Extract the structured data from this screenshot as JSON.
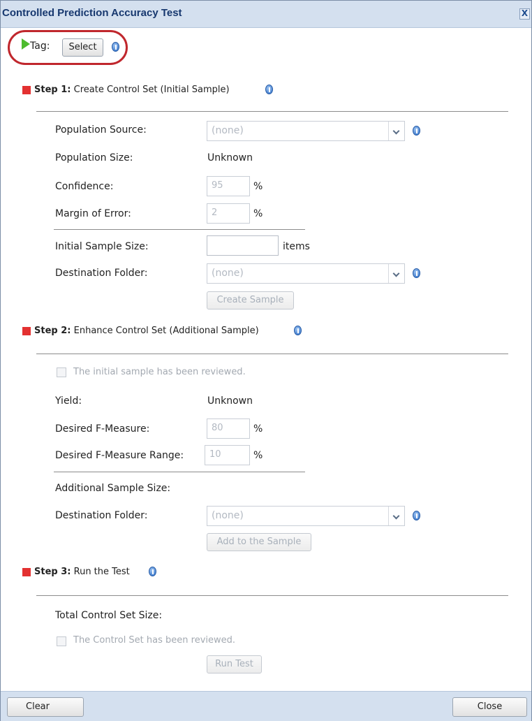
{
  "dialog": {
    "title": "Controlled Prediction Accuracy Test",
    "close_glyph": "X"
  },
  "tag": {
    "label": "Tag:",
    "select_label": "Select"
  },
  "step1": {
    "prefix": "Step 1:",
    "title": "Create Control Set (Initial Sample)",
    "population_source_label": "Population Source:",
    "population_source_value": "(none)",
    "population_size_label": "Population Size:",
    "population_size_value": "Unknown",
    "confidence_label": "Confidence:",
    "confidence_value": "95",
    "confidence_unit": "%",
    "margin_label": "Margin of Error:",
    "margin_value": "2",
    "margin_unit": "%",
    "initial_sample_label": "Initial Sample Size:",
    "initial_sample_value": "",
    "initial_sample_unit": "items",
    "destination_label": "Destination Folder:",
    "destination_value": "(none)",
    "create_sample_label": "Create Sample"
  },
  "step2": {
    "prefix": "Step 2:",
    "title": "Enhance Control Set (Additional Sample)",
    "reviewed_label": "The initial sample has been reviewed.",
    "yield_label": "Yield:",
    "yield_value": "Unknown",
    "fmeasure_label": "Desired F-Measure:",
    "fmeasure_value": "80",
    "fmeasure_unit": "%",
    "fmeasure_range_label": "Desired F-Measure Range:",
    "fmeasure_range_value": "10",
    "fmeasure_range_unit": "%",
    "additional_sample_label": "Additional Sample Size:",
    "destination_label": "Destination Folder:",
    "destination_value": "(none)",
    "add_sample_label": "Add to the Sample"
  },
  "step3": {
    "prefix": "Step 3:",
    "title": "Run the Test",
    "total_label": "Total Control Set Size:",
    "reviewed_label": "The Control Set has been reviewed.",
    "run_label": "Run Test"
  },
  "footer": {
    "clear_label": "Clear",
    "close_label": "Close"
  },
  "colors": {
    "titlebar": "#d4e0ef",
    "title_text": "#17386f",
    "step_marker": "#e33131",
    "play_icon": "#4dbb2e",
    "highlight": "#c0272d",
    "info_icon": "#2e6fc7"
  }
}
